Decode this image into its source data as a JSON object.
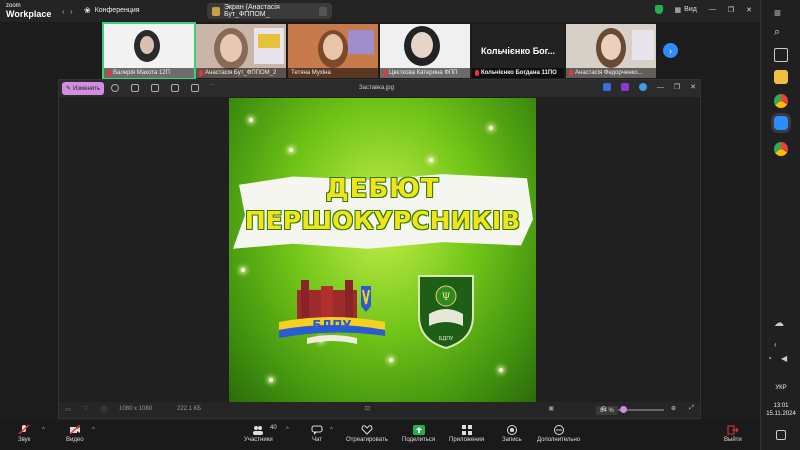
{
  "app": {
    "logo_line1": "zoom",
    "logo_line2": "Workplace",
    "conference_label": "Конференция"
  },
  "share": {
    "title": "Экран (Анастасія Бут_ФППОМ_"
  },
  "top_right": {
    "view_label": "Вид"
  },
  "participants_strip": [
    {
      "name": "Валерія Махота 12П",
      "muted": true
    },
    {
      "name": "Анастасія Бут_ФППОМ_2",
      "muted": true
    },
    {
      "name": "Тетяна Мухіна",
      "muted": false
    },
    {
      "name": "Цвєткова Катерина ФПП",
      "muted": true
    },
    {
      "name": "Кольчієнко Богдана 11ПО",
      "muted": true,
      "big_name": "Кольчієнко Бог..."
    },
    {
      "name": "Анастасія Федорченко...",
      "muted": true
    }
  ],
  "viewer": {
    "edit_label": "Изменить",
    "file_name": "Заставка.jpg",
    "dims": "1080 x 1080",
    "size": "222.1 КБ",
    "zoom": "84 %"
  },
  "poster": {
    "line1": "ДЕБЮТ",
    "line2": "ПЕРШОКУРСНИКІВ",
    "logo1_text": "БДПУ",
    "logo2_text": "БДПУ"
  },
  "controls": {
    "audio": "Звук",
    "video": "Видео",
    "participants": "Участники",
    "participants_count": "40",
    "chat": "Чат",
    "react": "Отреагировать",
    "share": "Поделиться",
    "apps": "Приложения",
    "record": "Запись",
    "more": "Дополнительно",
    "leave": "Выйти"
  },
  "taskbar": {
    "lang": "УКР",
    "time": "13:01",
    "date": "15.11.2024"
  },
  "colors": {
    "accent": "#2d8cff",
    "edit": "#d18ee0",
    "active": "#3ad07a",
    "title_yellow": "#f5e31a"
  }
}
